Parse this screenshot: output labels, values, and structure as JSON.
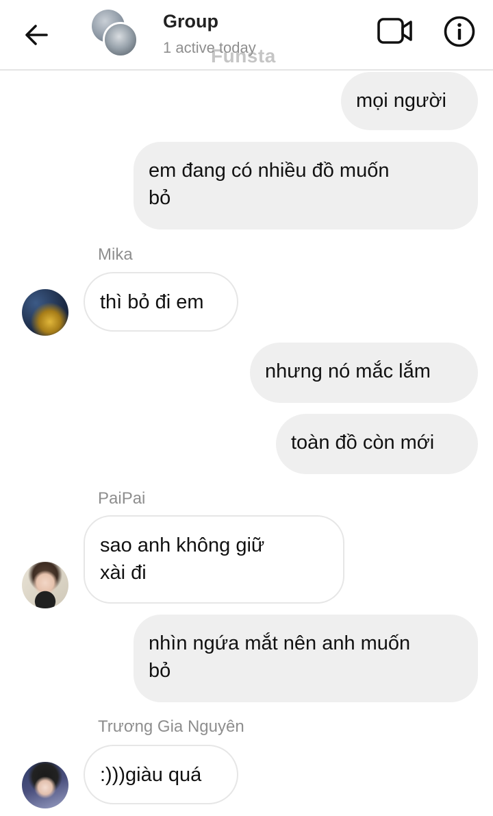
{
  "header": {
    "title": "Group",
    "subtitle": "1 active today",
    "watermark": "Funsta",
    "back_icon": "arrow-left-icon",
    "video_icon": "video-camera-icon",
    "info_icon": "info-circle-icon"
  },
  "messages": [
    {
      "direction": "outgoing",
      "text_lines": [
        "mọi người"
      ]
    },
    {
      "direction": "outgoing",
      "text_lines": [
        "em đang có nhiều đồ muốn",
        "bỏ"
      ]
    },
    {
      "direction": "incoming",
      "sender": "Mika",
      "text_lines": [
        "thì bỏ đi em"
      ]
    },
    {
      "direction": "outgoing",
      "text_lines": [
        "nhưng nó mắc lắm"
      ]
    },
    {
      "direction": "outgoing",
      "text_lines": [
        "toàn đồ còn mới"
      ]
    },
    {
      "direction": "incoming",
      "sender": "PaiPai",
      "text_lines": [
        "sao anh không giữ",
        "xài đi"
      ]
    },
    {
      "direction": "outgoing",
      "text_lines": [
        "nhìn ngứa mắt nên anh muốn",
        "bỏ"
      ]
    },
    {
      "direction": "incoming",
      "sender": "Trương Gia Nguyên",
      "text_lines": [
        ":)))giàu quá"
      ]
    }
  ],
  "colors": {
    "outgoing_bubble": "#efefef",
    "incoming_bubble_border": "#e6e6e6",
    "secondary_text": "#8e8e8e"
  }
}
